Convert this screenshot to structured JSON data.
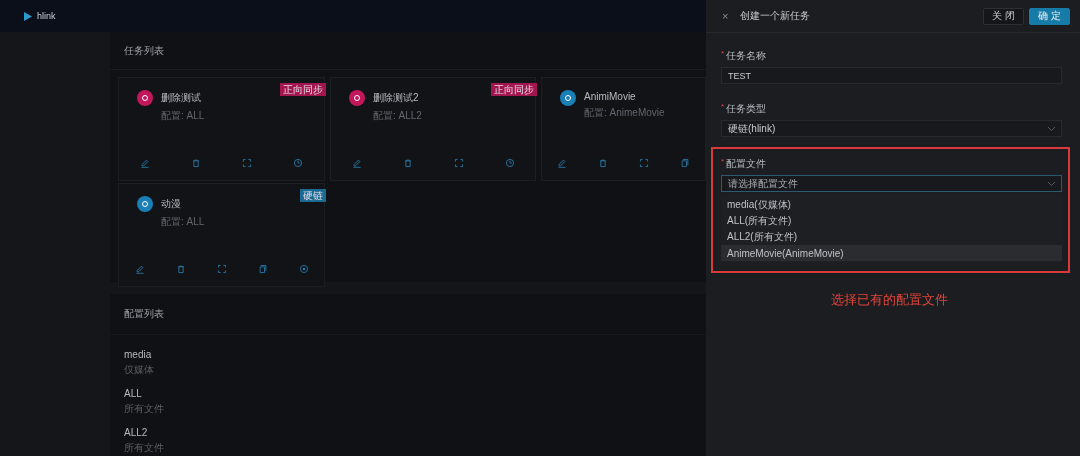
{
  "header": {
    "app_name": "hlink"
  },
  "task_panel": {
    "title": "任务列表",
    "tasks": [
      {
        "name": "删除测试",
        "config": "配置: ALL",
        "color": "#c2185b",
        "tag": {
          "text": "正向同步",
          "color": "#a3154f"
        },
        "actions": [
          {
            "kind": "edit"
          },
          {
            "kind": "delete"
          },
          {
            "kind": "expand"
          },
          {
            "kind": "clock"
          }
        ]
      },
      {
        "name": "删除测试2",
        "config": "配置: ALL2",
        "color": "#c2185b",
        "tag": {
          "text": "正向同步",
          "color": "#a3154f"
        },
        "actions": [
          {
            "kind": "edit"
          },
          {
            "kind": "delete"
          },
          {
            "kind": "expand"
          },
          {
            "kind": "clock"
          }
        ]
      },
      {
        "name": "AnimiMovie",
        "config": "配置: AnimeMovie",
        "color": "#1a7fb5",
        "actions": [
          {
            "kind": "edit"
          },
          {
            "kind": "delete"
          },
          {
            "kind": "expand"
          },
          {
            "kind": "copy"
          }
        ]
      },
      {
        "name": "动漫",
        "config": "配置: ALL",
        "color": "#1a7fb5",
        "tag": {
          "text": "硬链",
          "color": "#1b6a93"
        },
        "actions": [
          {
            "kind": "edit"
          },
          {
            "kind": "delete"
          },
          {
            "kind": "expand"
          },
          {
            "kind": "copy"
          },
          {
            "kind": "settings"
          }
        ]
      }
    ]
  },
  "config_panel": {
    "title": "配置列表",
    "items": [
      {
        "name": "media",
        "description": "仅媒体"
      },
      {
        "name": "ALL",
        "description": "所有文件"
      },
      {
        "name": "ALL2",
        "description": "所有文件"
      }
    ]
  },
  "drawer": {
    "close": "×",
    "title": "创建一个新任务",
    "buttons": [
      {
        "label": "关 闭",
        "kind": "default"
      },
      {
        "label": "确 定",
        "kind": "primary"
      }
    ],
    "fields": [
      {
        "label": "任务名称",
        "kind": "input",
        "required_mark": "*",
        "value": "TEST"
      },
      {
        "label": "任务类型",
        "kind": "select",
        "required_mark": "*",
        "value": "硬链(hlink)"
      },
      {
        "label": "配置文件",
        "kind": "dropdown",
        "required_mark": "*",
        "highlighted": true,
        "placeholder": "请选择配置文件",
        "options": [
          {
            "label": "media(仅媒体)",
            "selected": false
          },
          {
            "label": "ALL(所有文件)",
            "selected": false
          },
          {
            "label": "ALL2(所有文件)",
            "selected": false
          },
          {
            "label": "AnimeMovie(AnimeMovie)",
            "selected": true
          }
        ]
      }
    ],
    "annotation": "选择已有的配置文件"
  }
}
